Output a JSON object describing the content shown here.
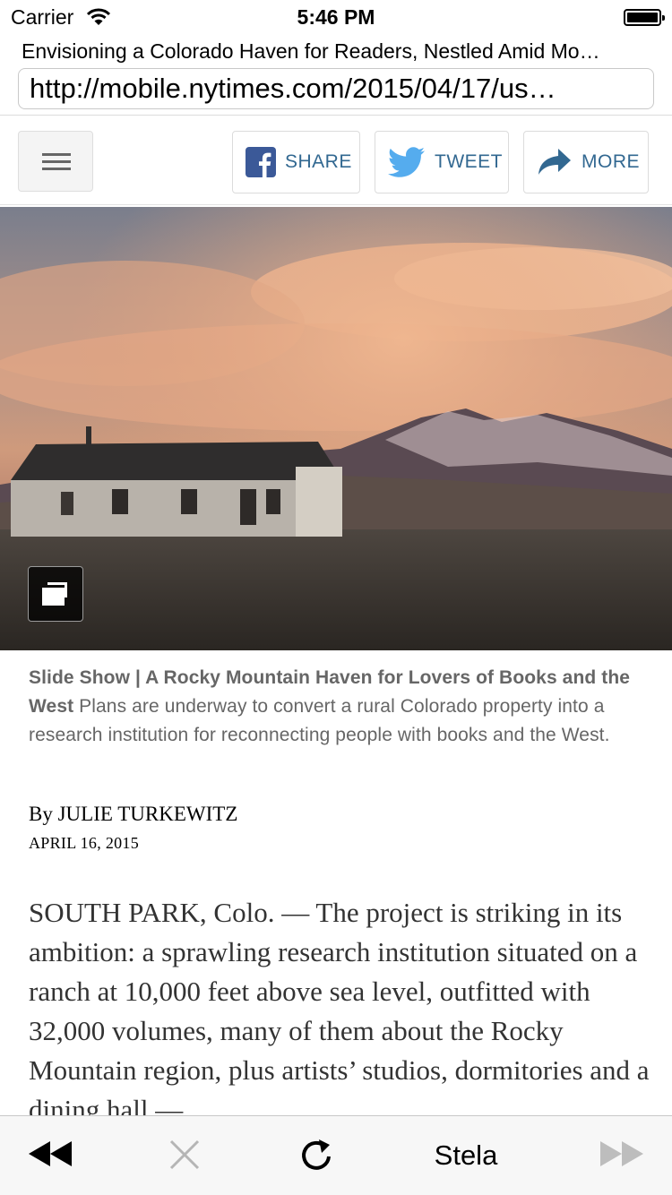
{
  "status_bar": {
    "carrier": "Carrier",
    "time": "5:46 PM"
  },
  "browser": {
    "page_title": "Envisioning a Colorado Haven for Readers, Nestled Amid Mo…",
    "url": "http://mobile.nytimes.com/2015/04/17/us…"
  },
  "toolbar": {
    "share_label": "SHARE",
    "tweet_label": "TWEET",
    "more_label": "MORE"
  },
  "hero": {
    "icon": "slideshow-icon"
  },
  "caption": {
    "title": "Slide Show | A Rocky Mountain Haven for Lovers of Books and the West",
    "text": " Plans are underway to convert a rural Colorado property into a research institution for reconnecting people with books and the West."
  },
  "article": {
    "byline": "By JULIE TURKEWITZ",
    "date": "APRIL 16, 2015",
    "body": "SOUTH PARK, Colo. — The project is striking in its ambition: a sprawling research institution situated on a ranch at 10,000 feet above sea level, outfitted with 32,000 volumes, many of them about the Rocky Mountain region, plus artists’ studios, dormitories and a dining hall —"
  },
  "bottom_bar": {
    "label": "Stela",
    "icons": [
      "rewind-icon",
      "stop-icon",
      "reload-icon",
      "fast-forward-icon"
    ]
  },
  "colors": {
    "accent": "#326891",
    "caption_text": "#666666",
    "body_text": "#333333"
  }
}
